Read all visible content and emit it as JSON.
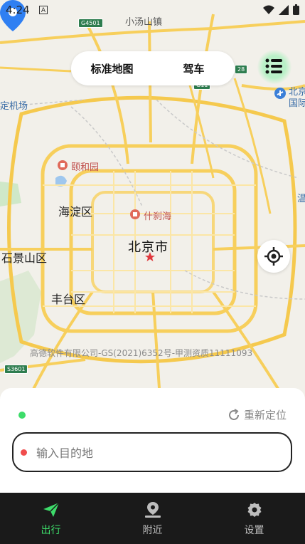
{
  "status_bar": {
    "time": "4:24",
    "notif_icon": "A"
  },
  "map": {
    "labels": {
      "xiaotangshan": "小汤山镇",
      "airport_left": "定机场",
      "beijing_capital": "北京",
      "guoji": "国际",
      "yiheyuan": "颐和园",
      "haidian": "海淀区",
      "shichahai": "什刹海",
      "beijing_city": "北京市",
      "shijingshan": "石景山区",
      "fengtai": "丰台区",
      "right_edge": "温"
    },
    "highways": {
      "g4501": "G4501",
      "s28": "28",
      "s3601": "S3601",
      "g11": "G11"
    },
    "copyright": "高德软件有限公司-GS(2021)6352号-甲测资质11111093"
  },
  "mode_switch": {
    "map_type": "标准地图",
    "travel_mode": "驾车"
  },
  "panel": {
    "relocate_label": "重新定位",
    "destination_placeholder": "输入目的地"
  },
  "nav": [
    {
      "label": "出行"
    },
    {
      "label": "附近"
    },
    {
      "label": "设置"
    }
  ],
  "colors": {
    "accent": "#3ddc6a",
    "pin": "#2f7ff2",
    "dest_dot": "#f04d4d"
  }
}
